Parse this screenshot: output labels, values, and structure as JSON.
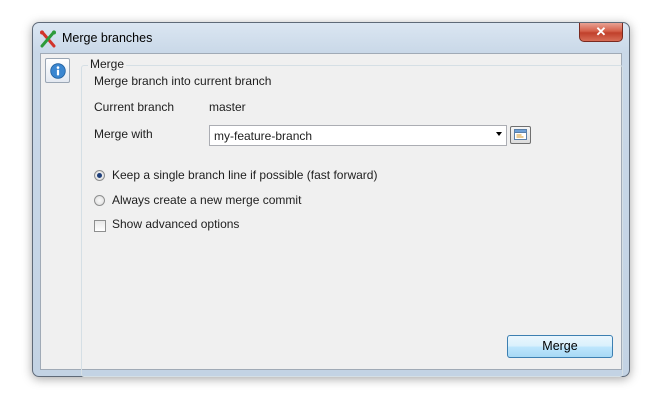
{
  "window": {
    "title": "Merge branches",
    "close_label": "✕"
  },
  "icons": {
    "app": "git-merge-icon",
    "info": "info-icon",
    "browse": "browse-branches-icon"
  },
  "group": {
    "title": "Merge",
    "description": "Merge branch into current branch",
    "current_branch_label": "Current branch",
    "current_branch_value": "master",
    "merge_with_label": "Merge with",
    "merge_with_value": "my-feature-branch"
  },
  "options": {
    "fast_forward": {
      "label": "Keep a single branch line if possible (fast forward)",
      "selected": true
    },
    "no_ff": {
      "label": "Always create a new merge commit",
      "selected": false
    },
    "advanced": {
      "label": "Show advanced options",
      "checked": false
    }
  },
  "actions": {
    "merge_label": "Merge"
  },
  "colors": {
    "accent": "#3c7fb1",
    "app_icon_red": "#d2342a",
    "app_icon_green": "#2e9b3a"
  }
}
